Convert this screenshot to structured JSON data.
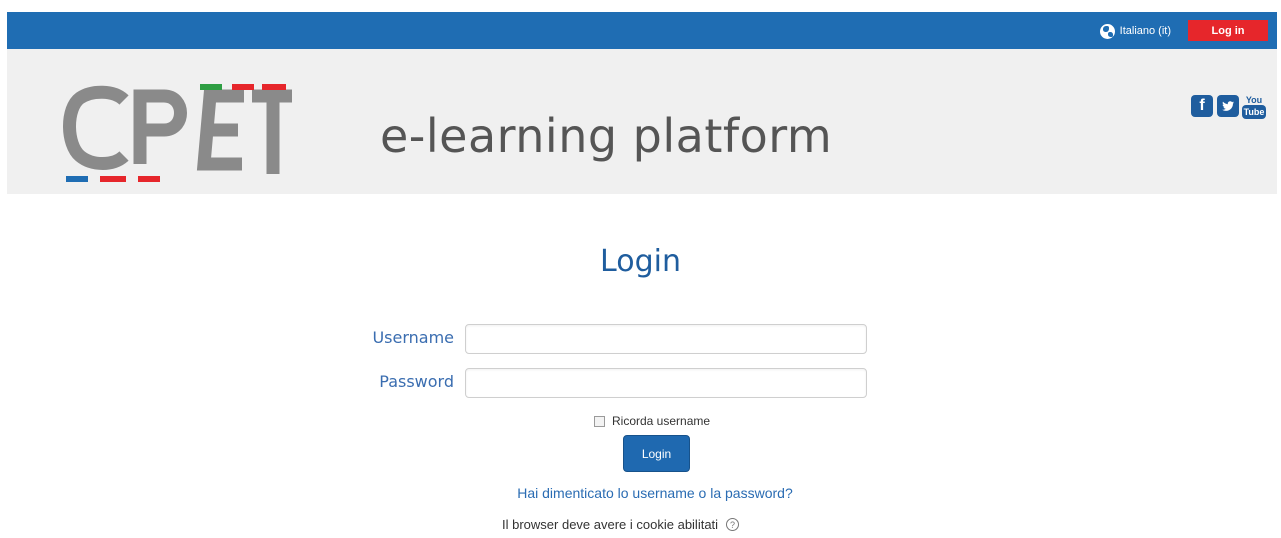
{
  "navbar": {
    "language_label": "Italiano (it)",
    "login_label": "Log in",
    "bg_color": "#1f6db3",
    "login_color": "#e6262b"
  },
  "header": {
    "tagline": "e-learning platform",
    "social": {
      "facebook": "f",
      "youtube_top": "You",
      "youtube_bottom": "Tube"
    }
  },
  "login": {
    "title": "Login",
    "username_label": "Username",
    "username_value": "",
    "password_label": "Password",
    "password_value": "",
    "remember_label": "Ricorda username",
    "remember_checked": false,
    "submit_label": "Login",
    "forgot_link": "Hai dimenticato lo username o la password?",
    "cookies_note": "Il browser deve avere i cookie abilitati"
  },
  "icons": {
    "language": "globe-icon",
    "facebook": "facebook-icon",
    "twitter": "twitter-icon",
    "youtube": "youtube-icon",
    "help": "help-icon"
  }
}
